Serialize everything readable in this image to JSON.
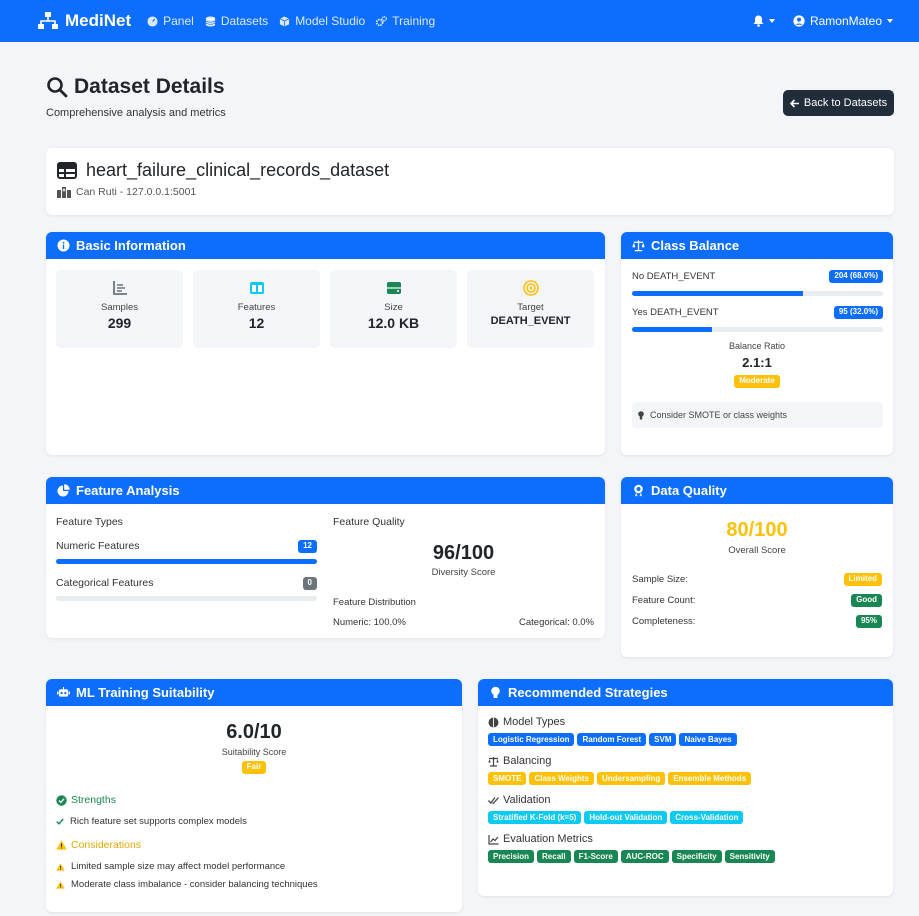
{
  "nav": {
    "brand": "MediNet",
    "items": [
      {
        "label": "Panel",
        "icon": "gauge-icon"
      },
      {
        "label": "Datasets",
        "icon": "database-icon"
      },
      {
        "label": "Model Studio",
        "icon": "cube-icon"
      },
      {
        "label": "Training",
        "icon": "cogs-icon"
      }
    ],
    "user": "RamonMateo"
  },
  "header": {
    "title": "Dataset Details",
    "subtitle": "Comprehensive analysis and metrics",
    "back_label": "Back to Datasets"
  },
  "dataset": {
    "name": "heart_failure_clinical_records_dataset",
    "host": "Can Ruti - 127.0.0.1:5001"
  },
  "basic": {
    "title": "Basic Information",
    "stats": [
      {
        "label": "Samples",
        "value": "299"
      },
      {
        "label": "Features",
        "value": "12"
      },
      {
        "label": "Size",
        "value": "12.0 KB"
      },
      {
        "label": "Target",
        "value": "DEATH_EVENT"
      }
    ]
  },
  "balance": {
    "title": "Class Balance",
    "classes": [
      {
        "label": "No DEATH_EVENT",
        "badge": "204 (68.0%)",
        "fraction": 0.68
      },
      {
        "label": "Yes DEATH_EVENT",
        "badge": "95 (32.0%)",
        "fraction": 0.32
      }
    ],
    "ratio_label": "Balance Ratio",
    "ratio": "2.1:1",
    "ratio_badge": "Moderate",
    "tip": "Consider SMOTE or class weights"
  },
  "features": {
    "title": "Feature Analysis",
    "types_title": "Feature Types",
    "numeric_label": "Numeric Features",
    "numeric_count": "12",
    "numeric_fraction": 1.0,
    "categorical_label": "Categorical Features",
    "categorical_count": "0",
    "categorical_fraction": 0.0,
    "quality_title": "Feature Quality",
    "diversity": "96/100",
    "diversity_label": "Diversity Score",
    "distribution_title": "Feature Distribution",
    "numeric_pct": "Numeric: 100.0%",
    "categorical_pct": "Categorical: 0.0%"
  },
  "quality": {
    "title": "Data Quality",
    "score": "80/100",
    "score_label": "Overall Score",
    "rows": [
      {
        "label": "Sample Size:",
        "badge": "Limited",
        "color": "#ffc107"
      },
      {
        "label": "Feature Count:",
        "badge": "Good",
        "color": "#198754"
      },
      {
        "label": "Completeness:",
        "badge": "95%",
        "color": "#198754"
      }
    ]
  },
  "ml": {
    "title": "ML Training Suitability",
    "score": "6.0/10",
    "score_label": "Suitability Score",
    "score_badge": "Fair",
    "strengths_title": "Strengths",
    "strengths": [
      "Rich feature set supports complex models"
    ],
    "considerations_title": "Considerations",
    "considerations": [
      "Limited sample size may affect model performance",
      "Moderate class imbalance - consider balancing techniques"
    ]
  },
  "strategies": {
    "title": "Recommended Strategies",
    "groups": [
      {
        "title": "Model Types",
        "icon": "brain-icon",
        "color": "#0d6efd",
        "chips": [
          "Logistic Regression",
          "Random Forest",
          "SVM",
          "Naive Bayes"
        ]
      },
      {
        "title": "Balancing",
        "icon": "scale-icon",
        "color": "#ffc107",
        "chips": [
          "SMOTE",
          "Class Weights",
          "Undersampling",
          "Ensemble Methods"
        ]
      },
      {
        "title": "Validation",
        "icon": "check-double-icon",
        "color": "#0dcaf0",
        "chips": [
          "Stratified K-Fold (k=5)",
          "Hold-out Validation",
          "Cross-Validation"
        ]
      },
      {
        "title": "Evaluation Metrics",
        "icon": "line-chart-icon",
        "color": "#198754",
        "chips": [
          "Precision",
          "Recall",
          "F1-Score",
          "AUC-ROC",
          "Specificity",
          "Sensitivity"
        ]
      }
    ]
  }
}
